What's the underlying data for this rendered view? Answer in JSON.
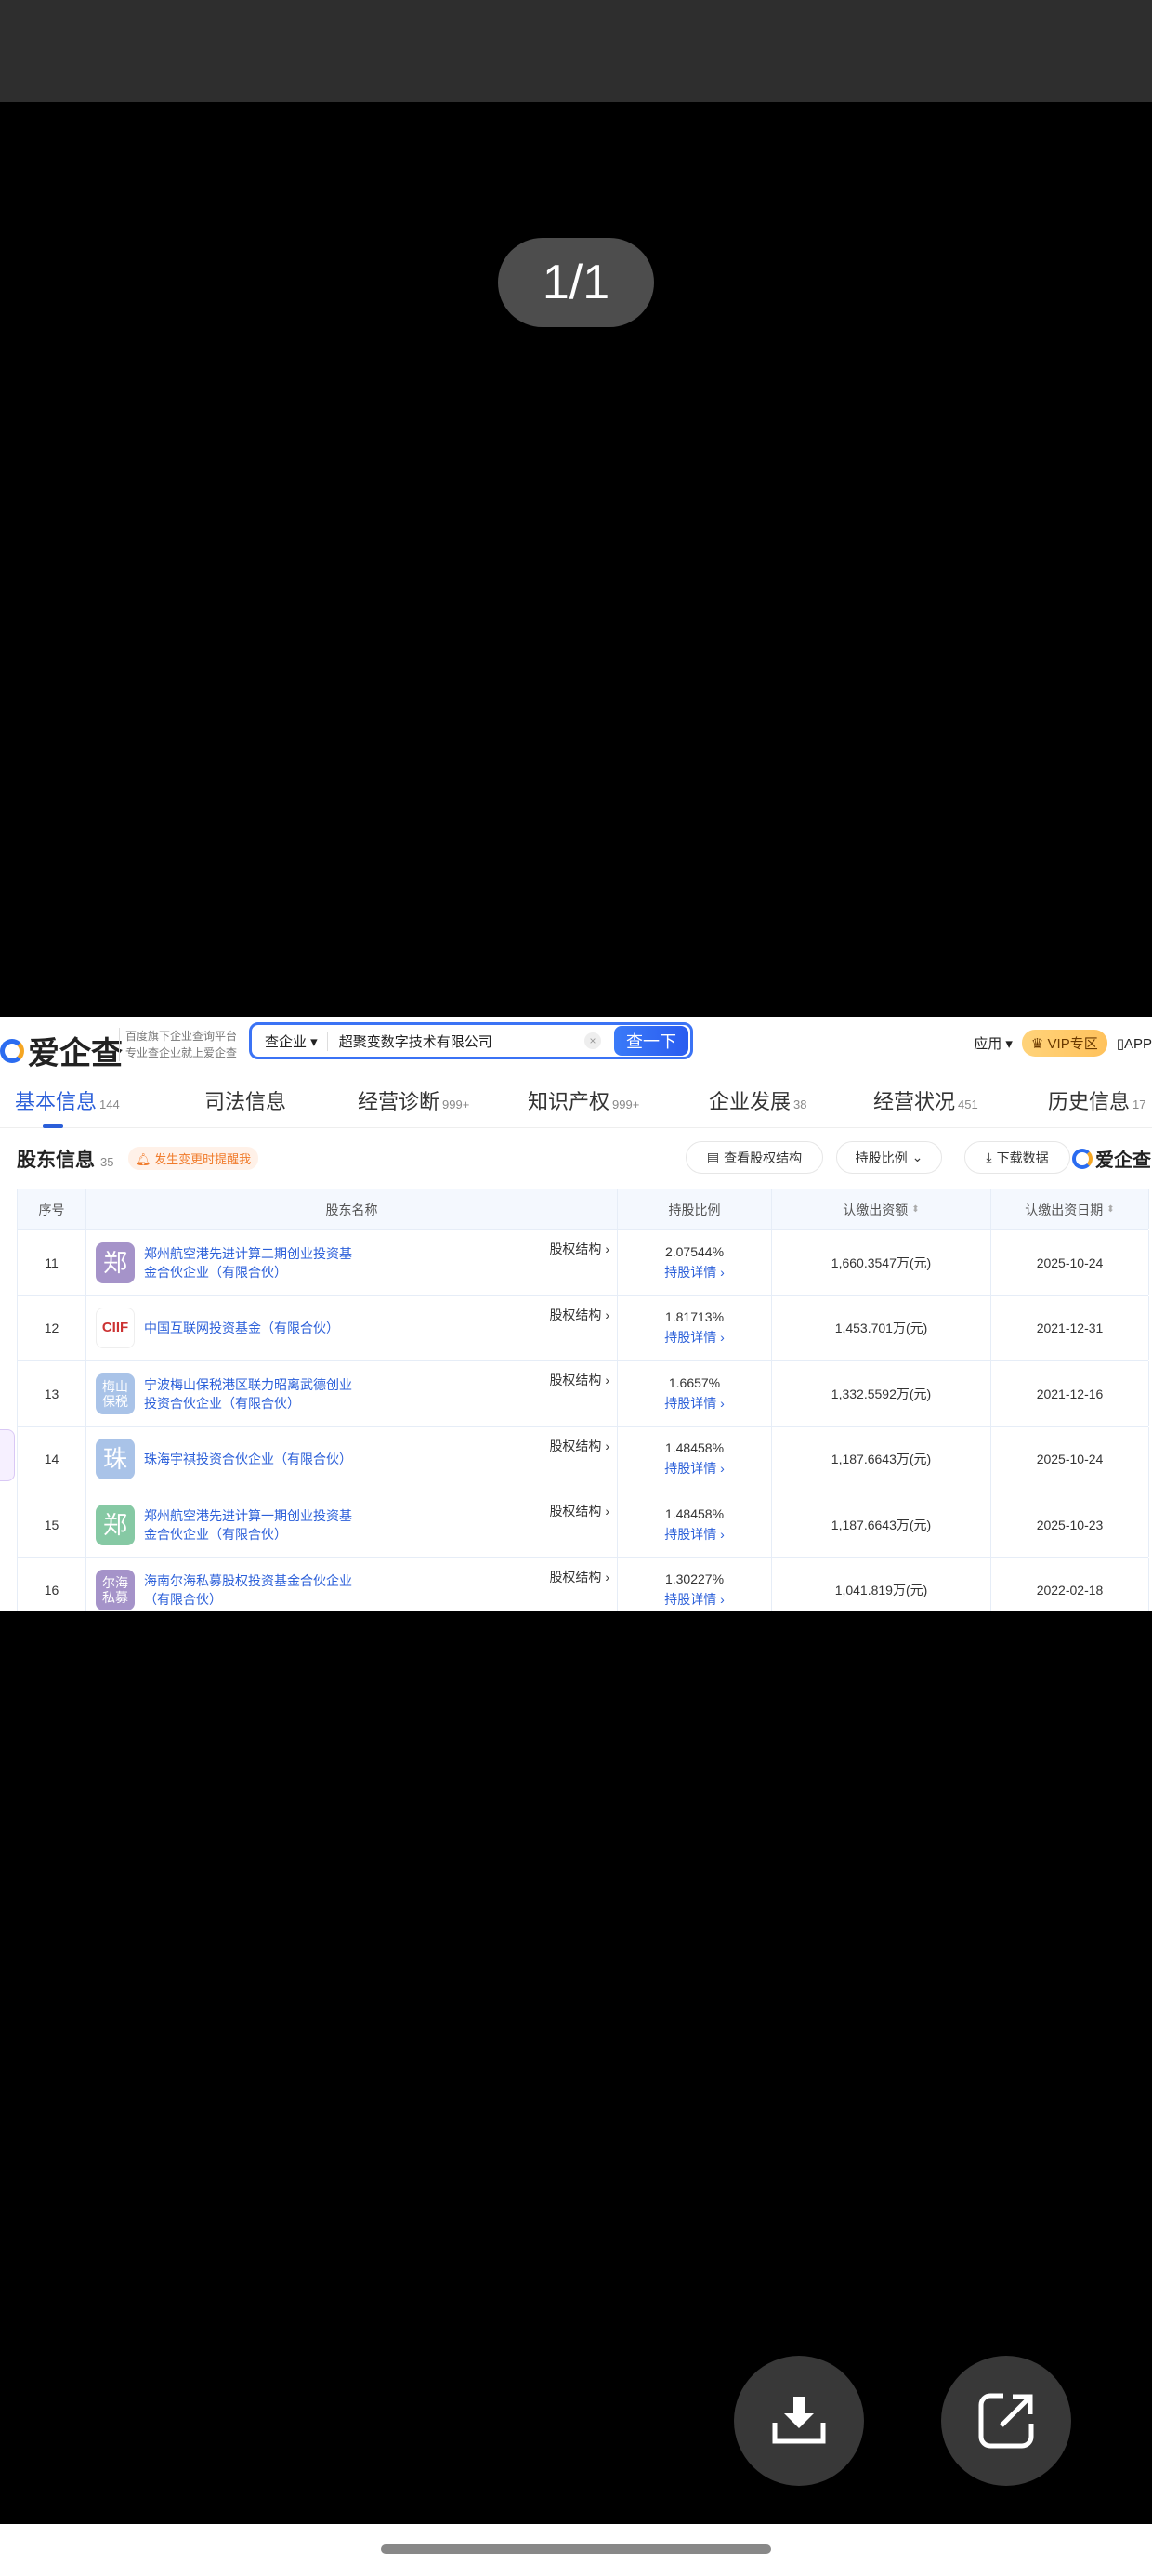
{
  "viewer": {
    "counter": "1/1"
  },
  "header": {
    "logo": "爱企查",
    "slogan1": "百度旗下企业查询平台",
    "slogan2": "专业查企业就上爱企查",
    "search_type": "查企业 ▾",
    "search_value": "超聚变数字技术有限公司",
    "search_button": "查一下",
    "apps": "应用 ▾",
    "vip": "VIP专区",
    "app": "APP"
  },
  "tabs": [
    {
      "label": "基本信息",
      "count": "144"
    },
    {
      "label": "司法信息",
      "count": ""
    },
    {
      "label": "经营诊断",
      "count": "999+"
    },
    {
      "label": "知识产权",
      "count": "999+"
    },
    {
      "label": "企业发展",
      "count": "38"
    },
    {
      "label": "经营状况",
      "count": "451"
    },
    {
      "label": "历史信息",
      "count": "17"
    }
  ],
  "section": {
    "title": "股东信息",
    "count": "35",
    "remind": "发生变更时提醒我",
    "view_structure": "查看股权结构",
    "ratio_dropdown": "持股比例",
    "download": "下载数据",
    "brand": "爱企查"
  },
  "table": {
    "headers": [
      "序号",
      "股东名称",
      "持股比例",
      "认缴出资额",
      "认缴出资日期"
    ],
    "struct_label": "股权结构 ›",
    "detail_label": "持股详情 ›",
    "rows": [
      {
        "no": "11",
        "avatar": "郑",
        "color": "#a593c9",
        "name": "郑州航空港先进计算二期创业投资基金合伙企业（有限合伙）",
        "pct": "2.07544%",
        "amount": "1,660.3547万(元)",
        "date": "2025-10-24"
      },
      {
        "no": "12",
        "avatar": "CIIF",
        "color": "#ffffff",
        "name": "中国互联网投资基金（有限合伙）",
        "pct": "1.81713%",
        "amount": "1,453.701万(元)",
        "date": "2021-12-31"
      },
      {
        "no": "13",
        "avatar": "梅山保税",
        "color": "#a9c3e8",
        "name": "宁波梅山保税港区联力昭离武德创业投资合伙企业（有限合伙）",
        "pct": "1.6657%",
        "amount": "1,332.5592万(元)",
        "date": "2021-12-16"
      },
      {
        "no": "14",
        "avatar": "珠",
        "color": "#a9c3e8",
        "name": "珠海宇祺投资合伙企业（有限合伙）",
        "pct": "1.48458%",
        "amount": "1,187.6643万(元)",
        "date": "2025-10-24"
      },
      {
        "no": "15",
        "avatar": "郑",
        "color": "#86c9a4",
        "name": "郑州航空港先进计算一期创业投资基金合伙企业（有限合伙）",
        "pct": "1.48458%",
        "amount": "1,187.6643万(元)",
        "date": "2025-10-23"
      },
      {
        "no": "16",
        "avatar": "尔海私募",
        "color": "#a593c9",
        "name": "海南尔海私募股权投资基金合伙企业（有限合伙）",
        "pct": "1.30227%",
        "amount": "1,041.819万(元)",
        "date": "2022-02-18"
      }
    ]
  }
}
